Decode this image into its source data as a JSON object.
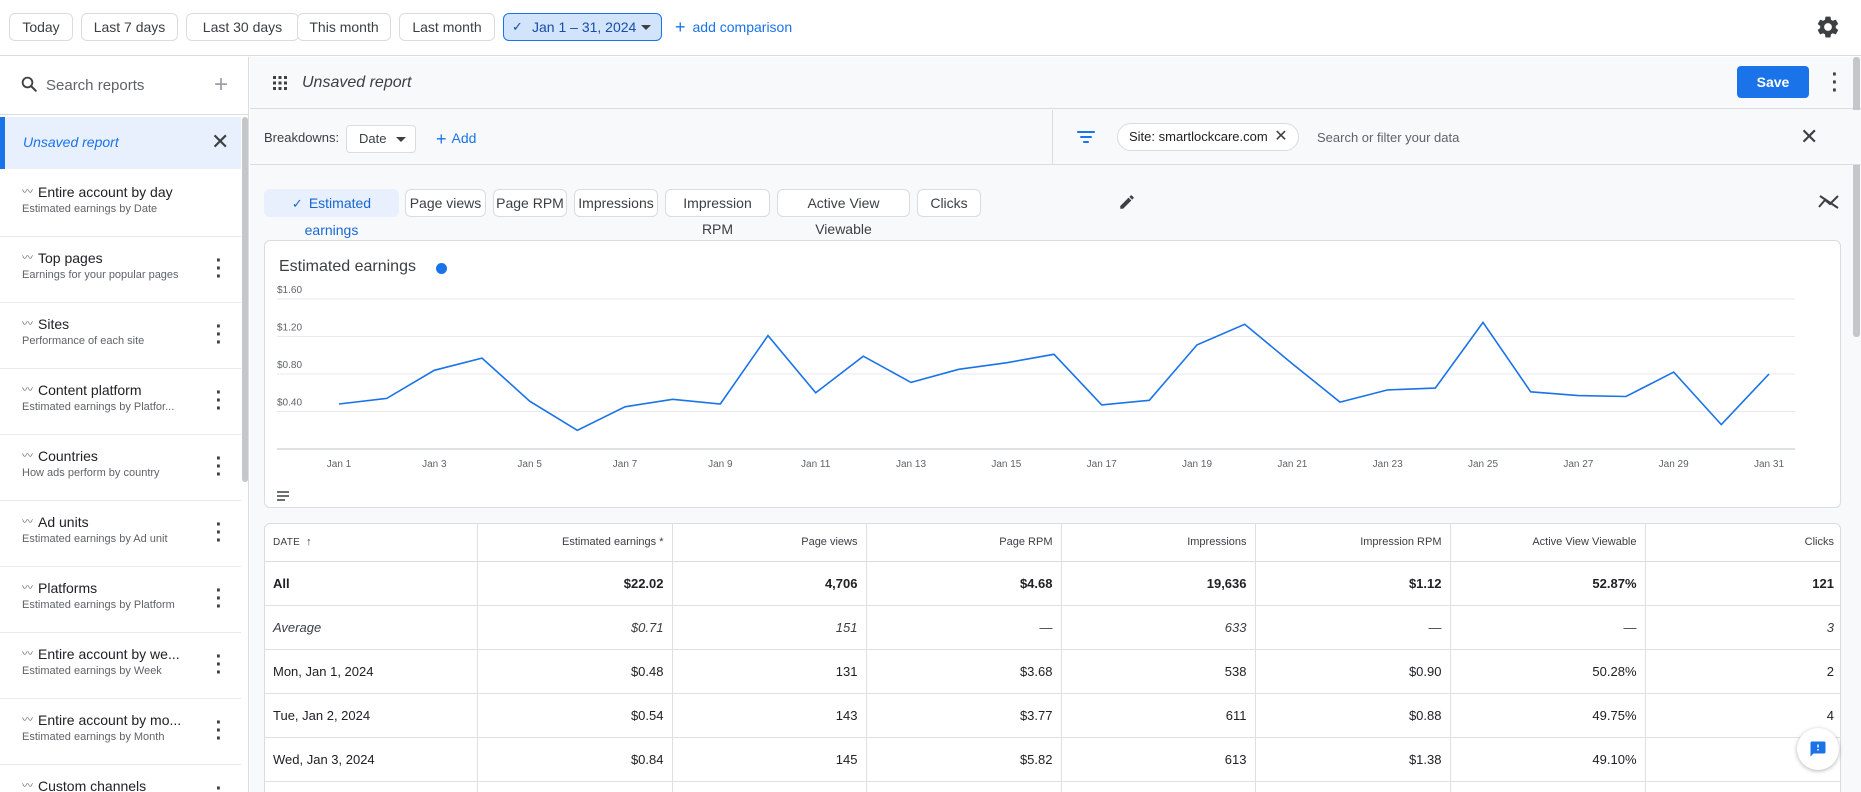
{
  "date_ranges": [
    {
      "label": "Today"
    },
    {
      "label": "Last 7 days"
    },
    {
      "label": "Last 30 days"
    },
    {
      "label": "This month"
    },
    {
      "label": "Last month"
    }
  ],
  "selected_range": "Jan 1 – 31, 2024",
  "add_comparison": "add comparison",
  "sidebar": {
    "search_placeholder": "Search reports",
    "active_report": "Unsaved report",
    "items": [
      {
        "title": "Entire account by day",
        "subtitle": "Estimated earnings by Date",
        "has_menu": false
      },
      {
        "title": "Top pages",
        "subtitle": "Earnings for your popular pages",
        "has_menu": true
      },
      {
        "title": "Sites",
        "subtitle": "Performance of each site",
        "has_menu": true
      },
      {
        "title": "Content platform",
        "subtitle": "Estimated earnings by Platfor...",
        "has_menu": true
      },
      {
        "title": "Countries",
        "subtitle": "How ads perform by country",
        "has_menu": true
      },
      {
        "title": "Ad units",
        "subtitle": "Estimated earnings by Ad unit",
        "has_menu": true
      },
      {
        "title": "Platforms",
        "subtitle": "Estimated earnings by Platform",
        "has_menu": true
      },
      {
        "title": "Entire account by we...",
        "subtitle": "Estimated earnings by Week",
        "has_menu": true
      },
      {
        "title": "Entire account by mo...",
        "subtitle": "Estimated earnings by Month",
        "has_menu": true
      },
      {
        "title": "Custom channels",
        "subtitle": "",
        "has_menu": true
      }
    ]
  },
  "report": {
    "name": "Unsaved report",
    "save_label": "Save"
  },
  "breakdowns": {
    "label": "Breakdowns:",
    "value": "Date",
    "add_label": "Add"
  },
  "filter": {
    "chip": "Site: smartlockcare.com",
    "placeholder": "Search or filter your data"
  },
  "metrics": [
    {
      "label": "Estimated earnings",
      "selected": true
    },
    {
      "label": "Page views",
      "selected": false
    },
    {
      "label": "Page RPM",
      "selected": false
    },
    {
      "label": "Impressions",
      "selected": false
    },
    {
      "label": "Impression RPM",
      "selected": false
    },
    {
      "label": "Active View Viewable",
      "selected": false
    },
    {
      "label": "Clicks",
      "selected": false
    }
  ],
  "chart_data": {
    "type": "line",
    "title": "Estimated earnings",
    "series_color": "#1a73e8",
    "x": [
      1,
      2,
      3,
      4,
      5,
      6,
      7,
      8,
      9,
      10,
      11,
      12,
      13,
      14,
      15,
      16,
      17,
      18,
      19,
      20,
      21,
      22,
      23,
      24,
      25,
      26,
      27,
      28,
      29,
      30,
      31
    ],
    "x_tick_labels": [
      "Jan 1",
      "Jan 3",
      "Jan 5",
      "Jan 7",
      "Jan 9",
      "Jan 11",
      "Jan 13",
      "Jan 15",
      "Jan 17",
      "Jan 19",
      "Jan 21",
      "Jan 23",
      "Jan 25",
      "Jan 27",
      "Jan 29",
      "Jan 31"
    ],
    "values": [
      0.48,
      0.54,
      0.84,
      0.97,
      0.51,
      0.2,
      0.45,
      0.53,
      0.48,
      1.21,
      0.6,
      0.99,
      0.71,
      0.85,
      0.92,
      1.01,
      0.47,
      0.52,
      1.11,
      1.33,
      0.91,
      0.5,
      0.63,
      0.65,
      1.35,
      0.61,
      0.57,
      0.56,
      0.82,
      0.26,
      0.8
    ],
    "y_tick_labels": [
      "$0.40",
      "$0.80",
      "$1.20",
      "$1.60"
    ],
    "y_ticks": [
      0.4,
      0.8,
      1.2,
      1.6
    ],
    "ylim": [
      0,
      1.6
    ],
    "grid": true
  },
  "table": {
    "headers": [
      "DATE",
      "Estimated earnings *",
      "Page views",
      "Page RPM",
      "Impressions",
      "Impression RPM",
      "Active View Viewable",
      "Clicks"
    ],
    "rows": [
      {
        "kind": "all",
        "cells": [
          "All",
          "$22.02",
          "4,706",
          "$4.68",
          "19,636",
          "$1.12",
          "52.87%",
          "121"
        ]
      },
      {
        "kind": "avg",
        "cells": [
          "Average",
          "$0.71",
          "151",
          "—",
          "633",
          "—",
          "—",
          "3"
        ]
      },
      {
        "kind": "row",
        "cells": [
          "Mon, Jan 1, 2024",
          "$0.48",
          "131",
          "$3.68",
          "538",
          "$0.90",
          "50.28%",
          "2"
        ]
      },
      {
        "kind": "row",
        "cells": [
          "Tue, Jan 2, 2024",
          "$0.54",
          "143",
          "$3.77",
          "611",
          "$0.88",
          "49.75%",
          "4"
        ]
      },
      {
        "kind": "row",
        "cells": [
          "Wed, Jan 3, 2024",
          "$0.84",
          "145",
          "$5.82",
          "613",
          "$1.38",
          "49.10%",
          ""
        ]
      },
      {
        "kind": "row",
        "cells": [
          "",
          "",
          "",
          "",
          "",
          "",
          "",
          ""
        ]
      }
    ]
  }
}
